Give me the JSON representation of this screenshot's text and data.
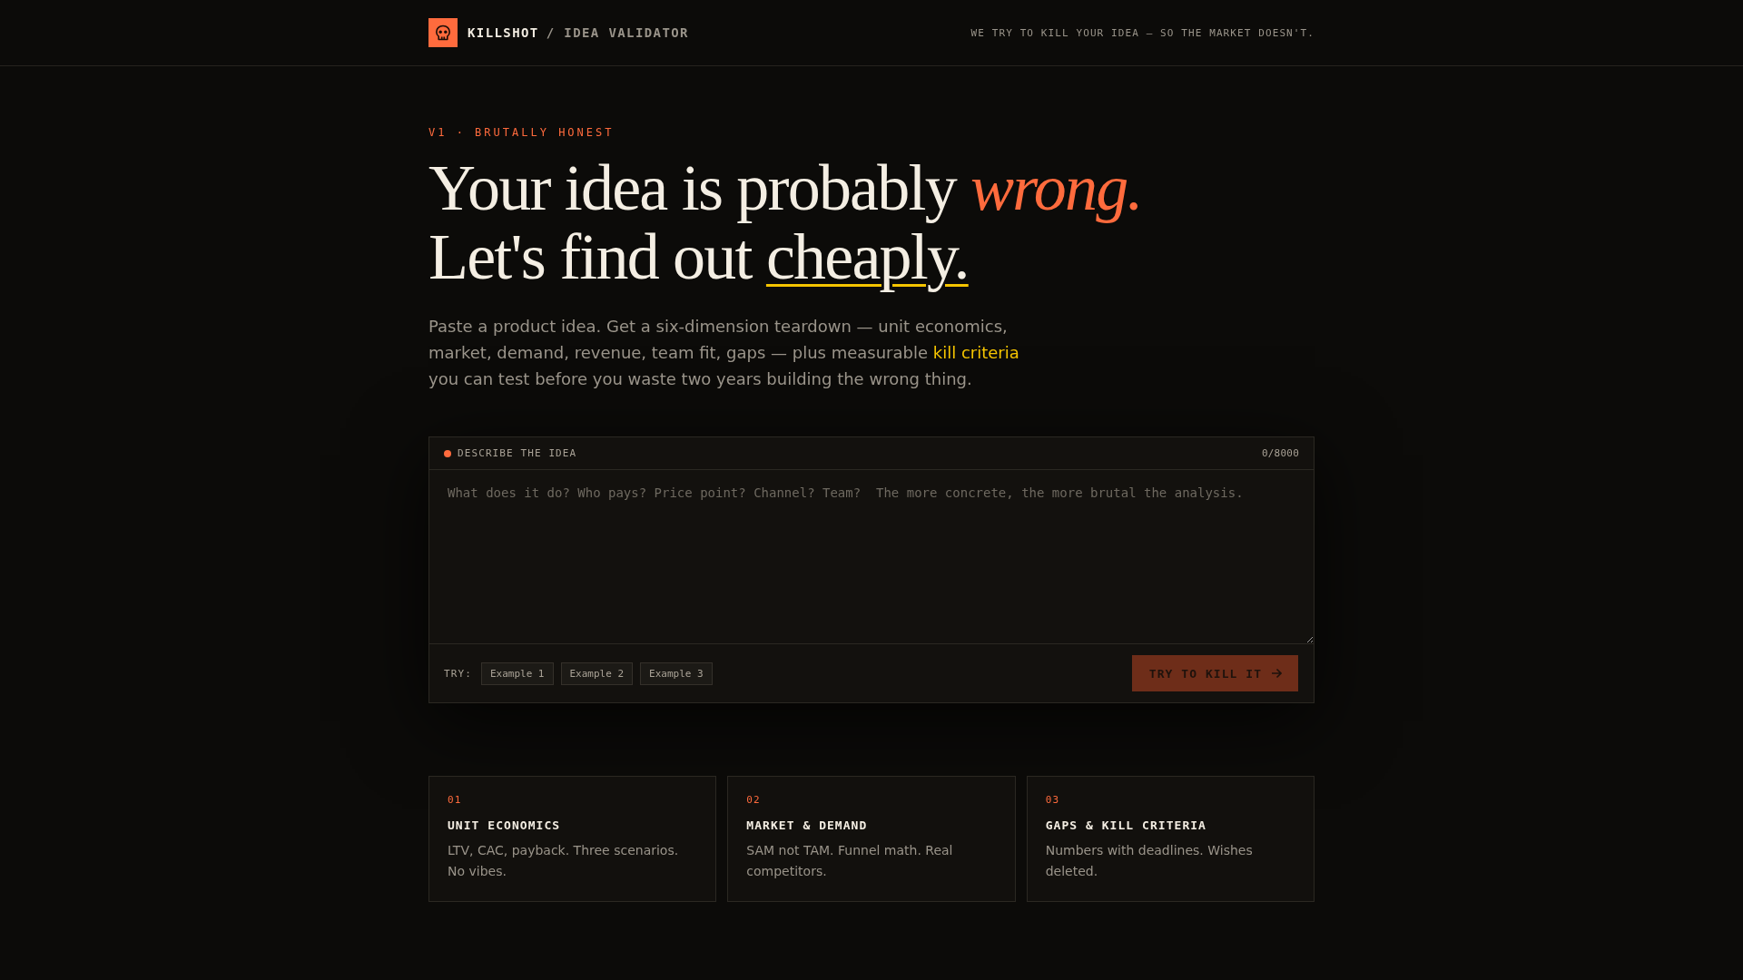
{
  "header": {
    "brand_name": "KILLSHOT",
    "brand_subtitle": "/ IDEA VALIDATOR",
    "tagline": "WE TRY TO KILL YOUR IDEA — SO THE MARKET DOESN'T."
  },
  "hero": {
    "eyebrow": "V1 · BRUTALLY HONEST",
    "headline": [
      {
        "parts": [
          {
            "text": "Your idea is probably ",
            "kind": "plain"
          },
          {
            "text": "wrong.",
            "kind": "accent"
          }
        ]
      },
      {
        "parts": [
          {
            "text": "Let's find out ",
            "kind": "plain"
          },
          {
            "text": "cheaply.",
            "kind": "underline"
          }
        ]
      }
    ],
    "intro": [
      {
        "text": "Paste a product idea. Get a six-dimension teardown — unit economics, market, demand, revenue, team fit, gaps — plus measurable ",
        "kind": "plain"
      },
      {
        "text": "kill criteria",
        "kind": "highlight"
      },
      {
        "text": " you can test before you waste two years building the wrong thing.",
        "kind": "plain"
      }
    ]
  },
  "input_panel": {
    "label": "DESCRIBE THE IDEA",
    "counter": "0/8000",
    "placeholder": "What does it do? Who pays? Price point? Channel? Team?  The more concrete, the more brutal the analysis.",
    "try_label": "TRY:",
    "examples": [
      "Example 1",
      "Example 2",
      "Example 3"
    ],
    "submit": {
      "label": "TRY TO KILL IT",
      "disabled": true
    }
  },
  "features": [
    {
      "number": "01",
      "title": "UNIT ECONOMICS",
      "description": "LTV, CAC, payback. Three scenarios. No vibes."
    },
    {
      "number": "02",
      "title": "MARKET & DEMAND",
      "description": "SAM not TAM. Funnel math. Real competitors."
    },
    {
      "number": "03",
      "title": "GAPS & KILL CRITERIA",
      "description": "Numbers with deadlines. Wishes deleted."
    }
  ]
}
